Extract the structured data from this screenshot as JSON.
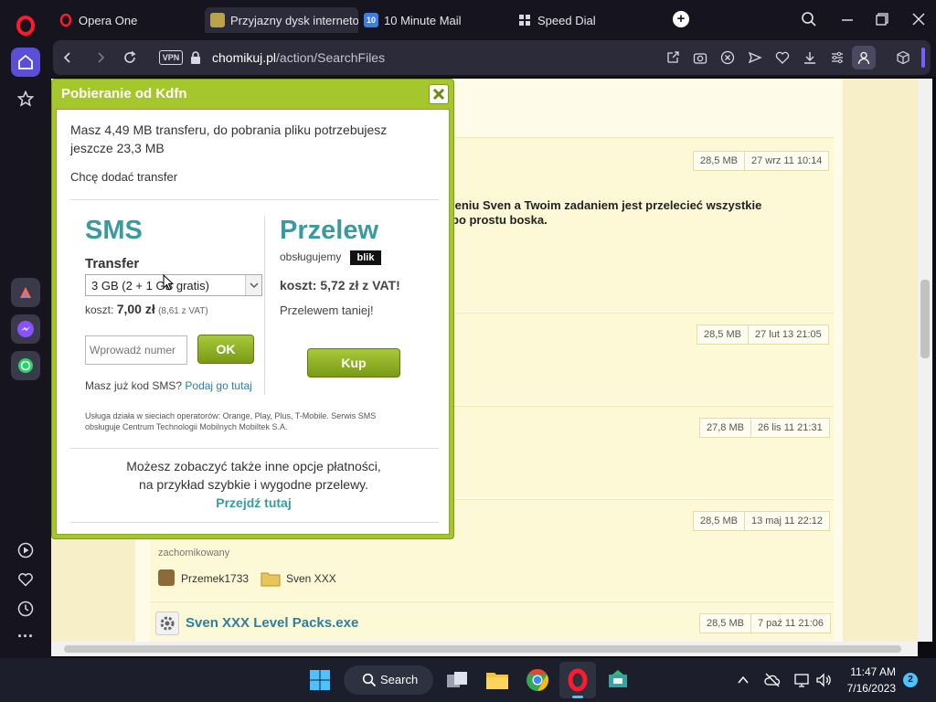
{
  "browser": {
    "tabs": [
      {
        "label": "Opera One"
      },
      {
        "label": "Przyjazny dysk internetow"
      },
      {
        "label": "10 Minute Mail"
      },
      {
        "label": "Speed Dial"
      }
    ],
    "vpn_label": "VPN",
    "url_domain": "chomikuj.pl",
    "url_path": "/action/SearchFiles",
    "favicon_10mm": "10"
  },
  "page": {
    "text_line1": "ieniu Sven a Twoim zadaniem jest przelecieć wszystkie",
    "text_line2": "po prostu boska.",
    "rows": [
      {
        "size": "28,5 MB",
        "date": "27 wrz 11 10:14"
      },
      {
        "size": "28,5 MB",
        "date": "27 lut 13 21:05"
      },
      {
        "size": "27,8 MB",
        "date": "26 lis 11 21:31"
      },
      {
        "size": "28,5 MB",
        "date": "13 maj 11 22:12"
      },
      {
        "size": "28,5 MB",
        "date": "7 paź 11 21:06"
      }
    ],
    "zachomikowany": "zachomikowany",
    "user1": "Przemek1733",
    "user2": "Sven XXX",
    "file_title": "Sven XXX Level Packs.exe"
  },
  "dialog": {
    "title": "Pobieranie od Kdfn",
    "info_line1": "Masz 4,49 MB transferu, do pobrania pliku potrzebujesz",
    "info_line2": "jeszcze 23,3 MB",
    "add_transfer": "Chcę dodać transfer",
    "sms": {
      "heading": "SMS",
      "transfer_label": "Transfer",
      "select_value": "3 GB (2 + 1 GB gratis)",
      "cost_prefix": "koszt: ",
      "cost_value": "7,00 zł",
      "cost_vat": "(8,61 z VAT)",
      "input_placeholder": "Wprowadź numer",
      "ok_label": "OK",
      "have_code": "Masz już kod SMS?",
      "enter_here": "Podaj go tutaj",
      "fineprint_1": "Usługa działa w sieciach operatorów: Orange, Play, Plus, T-Mobile. Serwis SMS",
      "fineprint_2": "obsługuje Centrum Technologii Mobilnych Mobiltek S.A."
    },
    "przelew": {
      "heading": "Przelew",
      "supports": "obsługujemy",
      "blik": "blik",
      "cost": "koszt: 5,72 zł z VAT!",
      "cheaper": "Przelewem taniej!",
      "buy_label": "Kup"
    },
    "other_line1": "Możesz zobaczyć także inne opcje płatności,",
    "other_line2": "na przykład szybkie i wygodne przelewy.",
    "other_link": "Przejdź tutaj"
  },
  "taskbar": {
    "search_label": "Search",
    "time": "11:47 AM",
    "date": "7/16/2023",
    "notification_count": "2"
  },
  "colors": {
    "dialog_green": "#a6c62e",
    "heading_teal": "#3a9aa0",
    "link": "#2b7fa0"
  }
}
